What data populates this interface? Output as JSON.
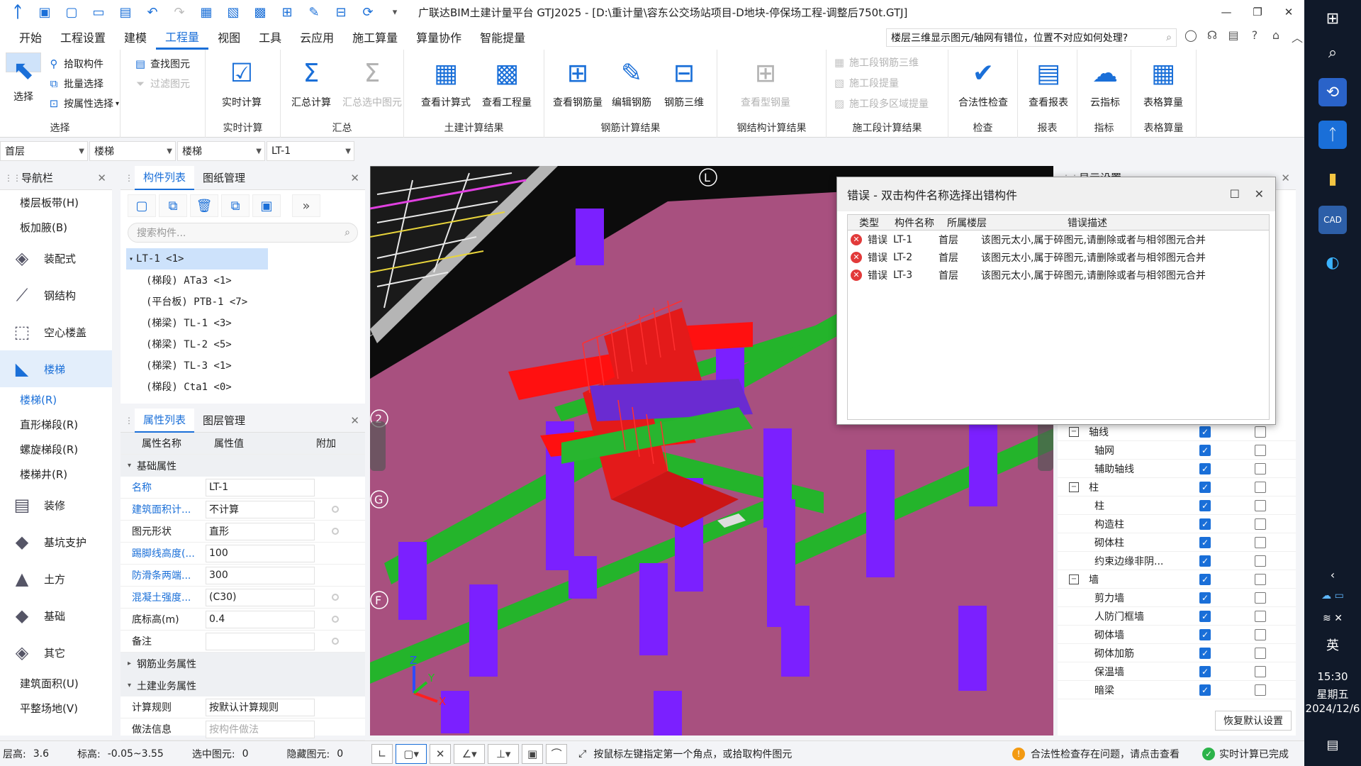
{
  "app": {
    "title": "广联达BIM土建计量平台 GTJ2025 - [D:\\重计量\\容东公交场站项目-D地块-停保场工程-调整后750t.GTJ]"
  },
  "quick_icons": [
    "app-logo-icon",
    "open-project-icon",
    "new-icon",
    "folder-icon",
    "save-icon",
    "undo-icon",
    "redo-icon",
    "calc-icon",
    "layer-icon",
    "grid-icon",
    "tree-icon",
    "draw-icon",
    "align-icon",
    "sync-icon",
    "more-icon"
  ],
  "menu": [
    "开始",
    "工程设置",
    "建模",
    "工程量",
    "视图",
    "工具",
    "云应用",
    "施工算量",
    "算量协作",
    "智能提量"
  ],
  "help_search": "楼层三维显示图元/轴网有错位，位置不对应如何处理?",
  "ribbon": {
    "select_group": {
      "label": "选择",
      "big": "选择",
      "small": [
        "拾取构件",
        "批量选择",
        "按属性选择"
      ],
      "small2": [
        "查找图元",
        "过滤图元"
      ]
    },
    "realtime": {
      "label": "实时计算",
      "btn": "实时计算"
    },
    "summary": {
      "label": "汇总",
      "btns": [
        "汇总计算",
        "汇总选中图元"
      ]
    },
    "civil": {
      "label": "土建计算结果",
      "btns": [
        "查看计算式",
        "查看工程量"
      ]
    },
    "rebar": {
      "label": "钢筋计算结果",
      "btns": [
        "查看钢筋量",
        "编辑钢筋",
        "钢筋三维"
      ]
    },
    "steel": {
      "label": "钢结构计算结果",
      "btns": [
        "查看型钢量"
      ]
    },
    "construction": {
      "label": "施工段计算结果",
      "items": [
        "施工段钢筋三维",
        "施工段提量",
        "施工段多区域提量"
      ]
    },
    "check": {
      "label": "检查",
      "btns": [
        "合法性检查"
      ]
    },
    "report": {
      "label": "报表",
      "btns": [
        "查看报表"
      ]
    },
    "index": {
      "label": "指标",
      "btns": [
        "云指标"
      ]
    },
    "table": {
      "label": "表格算量",
      "btns": [
        "表格算量"
      ]
    }
  },
  "selectors": [
    "首层",
    "楼梯",
    "楼梯",
    "LT-1"
  ],
  "nav": {
    "title": "导航栏",
    "top_items": [
      "楼层板带(H)",
      "板加腋(B)"
    ],
    "categories": [
      {
        "label": "装配式",
        "icon": "prefab-icon"
      },
      {
        "label": "钢结构",
        "icon": "steel-icon"
      },
      {
        "label": "空心楼盖",
        "icon": "hollow-slab-icon"
      },
      {
        "label": "楼梯",
        "icon": "stair-icon"
      }
    ],
    "stair_items": [
      "楼梯(R)",
      "直形梯段(R)",
      "螺旋梯段(R)",
      "楼梯井(R)"
    ],
    "categories2": [
      {
        "label": "装修",
        "icon": "decoration-icon"
      },
      {
        "label": "基坑支护",
        "icon": "pit-support-icon"
      },
      {
        "label": "土方",
        "icon": "earthwork-icon"
      },
      {
        "label": "基础",
        "icon": "foundation-icon"
      },
      {
        "label": "其它",
        "icon": "other-icon"
      }
    ],
    "bottom_items": [
      "建筑面积(U)",
      "平整场地(V)"
    ]
  },
  "component": {
    "tabs": [
      "构件列表",
      "图纸管理"
    ],
    "search_placeholder": "搜索构件...",
    "root": "LT-1 <1>",
    "children": [
      "(梯段) ATa3 <1>",
      "(平台板) PTB-1 <7>",
      "(梯梁) TL-1 <3>",
      "(梯梁) TL-2 <5>",
      "(梯梁) TL-3 <1>",
      "(梯段) Cta1 <0>"
    ]
  },
  "props": {
    "tabs": [
      "属性列表",
      "图层管理"
    ],
    "headers": [
      "属性名称",
      "属性值",
      "附加"
    ],
    "section1": "基础属性",
    "rows": [
      {
        "name": "名称",
        "value": "LT-1"
      },
      {
        "name": "建筑面积计...",
        "value": "不计算"
      },
      {
        "name": "图元形状",
        "value": "直形"
      },
      {
        "name": "踢脚线高度(...",
        "value": "100"
      },
      {
        "name": "防滑条两端...",
        "value": "300"
      },
      {
        "name": "混凝土强度...",
        "value": "(C30)"
      },
      {
        "name": "底标高(m)",
        "value": "0.4"
      },
      {
        "name": "备注",
        "value": ""
      }
    ],
    "section2": "钢筋业务属性",
    "section3": "土建业务属性",
    "rows2": [
      {
        "name": "计算规则",
        "value": "按默认计算规则"
      },
      {
        "name": "做法信息",
        "value": "按构件做法"
      }
    ]
  },
  "error_dialog": {
    "title": "错误 - 双击构件名称选择出错构件",
    "headers": [
      "类型",
      "构件名称",
      "所属楼层",
      "错误描述"
    ],
    "rows": [
      {
        "type": "错误",
        "name": "LT-1",
        "floor": "首层",
        "desc": "该图元太小,属于碎图元,请删除或者与相邻图元合并"
      },
      {
        "type": "错误",
        "name": "LT-2",
        "floor": "首层",
        "desc": "该图元太小,属于碎图元,请删除或者与相邻图元合并"
      },
      {
        "type": "错误",
        "name": "LT-3",
        "floor": "首层",
        "desc": "该图元太小,属于碎图元,请删除或者与相邻图元合并"
      }
    ]
  },
  "vis_panel": {
    "header": "显示设置",
    "groups": [
      {
        "name": "轴线",
        "items": [
          "轴网",
          "辅助轴线"
        ]
      },
      {
        "name": "柱",
        "items": [
          "柱",
          "构造柱",
          "砌体柱",
          "约束边缘非阴..."
        ]
      },
      {
        "name": "墙",
        "items": [
          "剪力墙",
          "人防门框墙",
          "砌体墙",
          "砌体加筋",
          "保温墙",
          "暗梁"
        ]
      }
    ],
    "reset": "恢复默认设置"
  },
  "viewport": {
    "axis_labels": [
      "L",
      "2",
      "G",
      "F"
    ],
    "axes": [
      "Z",
      "Y",
      "X"
    ]
  },
  "status": {
    "floor_h": "层高:",
    "floor_h_v": "3.6",
    "elev": "标高:",
    "elev_v": "-0.05~3.55",
    "selected": "选中图元:",
    "selected_v": "0",
    "hidden": "隐藏图元:",
    "hidden_v": "0",
    "hint": "按鼠标左键指定第一个角点，或拾取构件图元",
    "warn": "合法性检查存在问题，请点击查看",
    "ok": "实时计算已完成"
  },
  "taskbar": {
    "time": "15:30",
    "weekday": "星期五",
    "date": "2024/12/6",
    "ime": "英"
  }
}
